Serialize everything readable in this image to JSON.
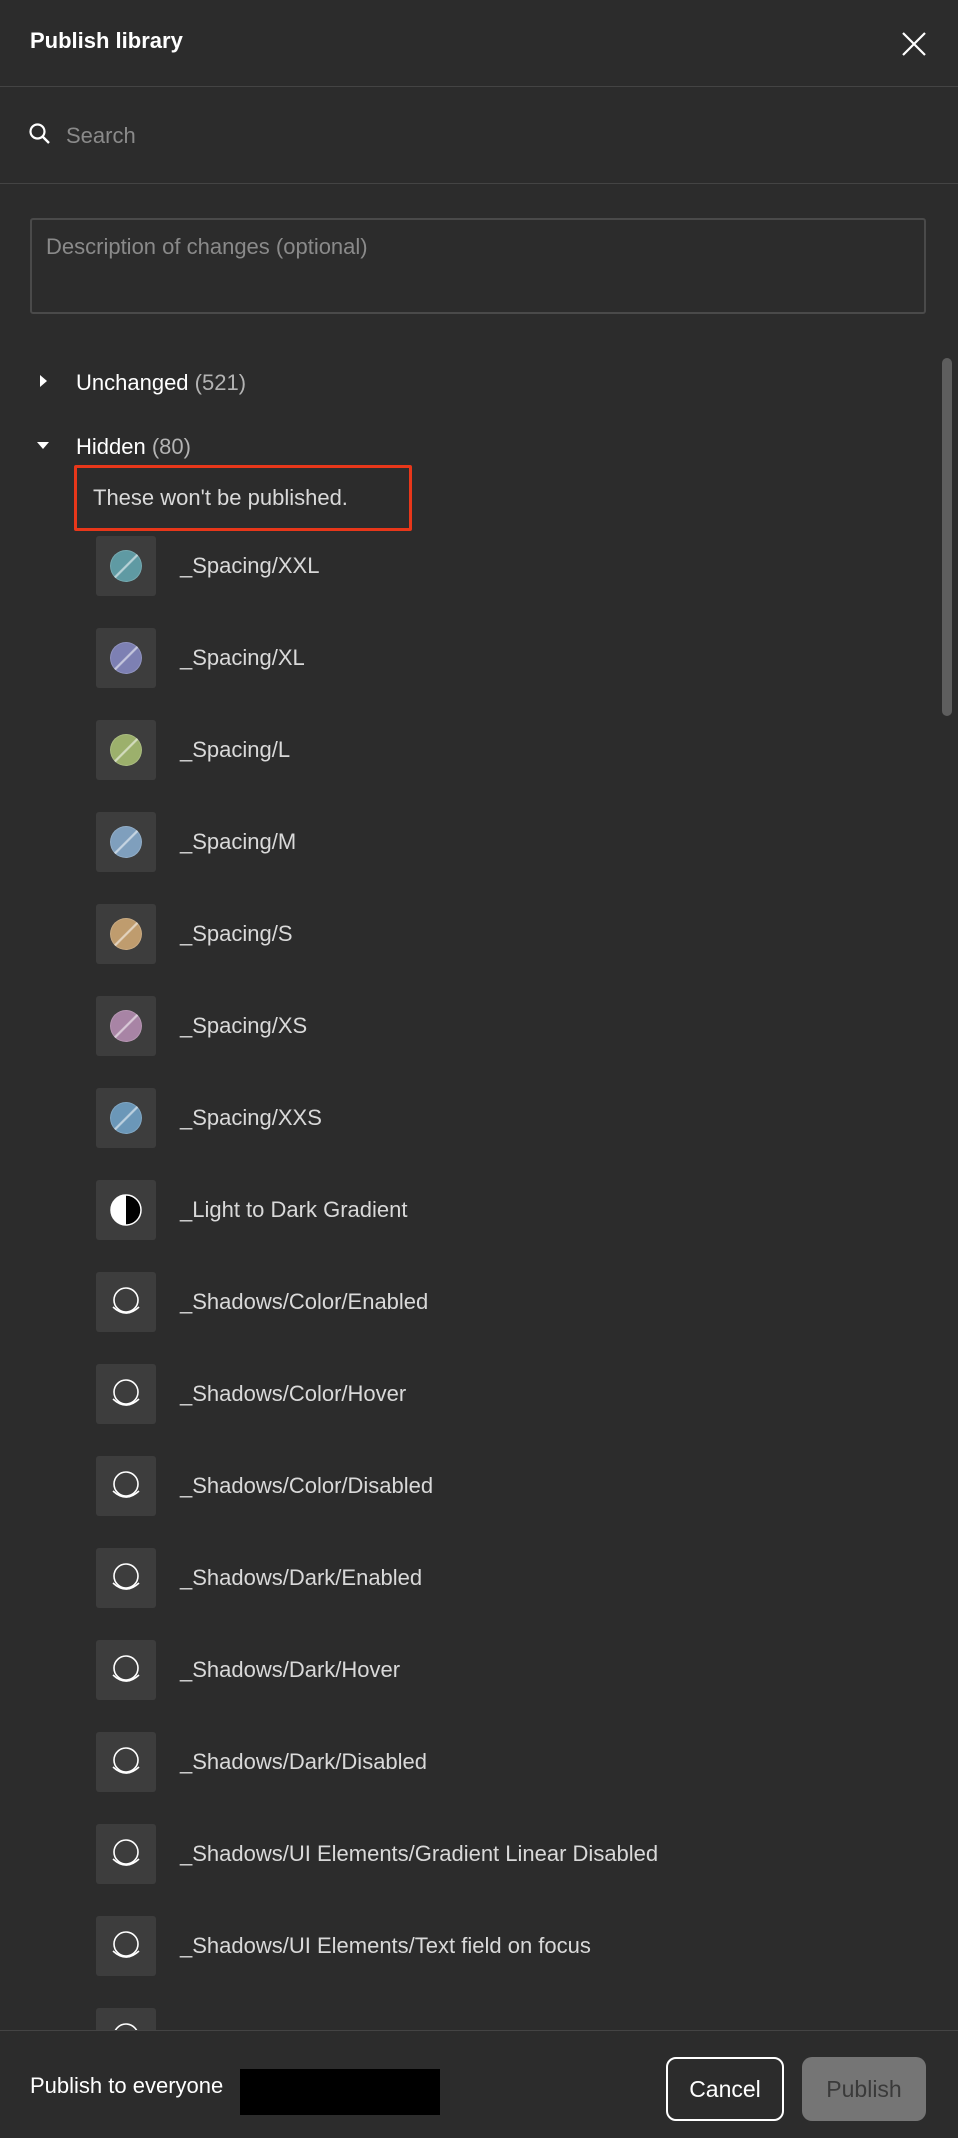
{
  "dialog": {
    "title": "Publish library"
  },
  "search": {
    "placeholder": "Search"
  },
  "description": {
    "placeholder": "Description of changes (optional)"
  },
  "groups": {
    "unchanged": {
      "label": "Unchanged",
      "count": "(521)",
      "expanded": false
    },
    "hidden": {
      "label": "Hidden",
      "count": "(80)",
      "expanded": true,
      "note": "These won't be published."
    }
  },
  "hidden_items": [
    {
      "label": "_Spacing/XXL",
      "icon": "color-swatch",
      "color": "#5f9aa3"
    },
    {
      "label": "_Spacing/XL",
      "icon": "color-swatch",
      "color": "#7d80b3"
    },
    {
      "label": "_Spacing/L",
      "icon": "color-swatch",
      "color": "#9cb06c"
    },
    {
      "label": "_Spacing/M",
      "icon": "color-swatch",
      "color": "#7f9fbd"
    },
    {
      "label": "_Spacing/S",
      "icon": "color-swatch",
      "color": "#bf9c6e"
    },
    {
      "label": "_Spacing/XS",
      "icon": "color-swatch",
      "color": "#a884a5"
    },
    {
      "label": "_Spacing/XXS",
      "icon": "color-swatch",
      "color": "#6b97b8"
    },
    {
      "label": "_Light to Dark Gradient",
      "icon": "gradient-swatch"
    },
    {
      "label": "_Shadows/Color/Enabled",
      "icon": "shadow-effect"
    },
    {
      "label": "_Shadows/Color/Hover",
      "icon": "shadow-effect"
    },
    {
      "label": "_Shadows/Color/Disabled",
      "icon": "shadow-effect"
    },
    {
      "label": "_Shadows/Dark/Enabled",
      "icon": "shadow-effect"
    },
    {
      "label": "_Shadows/Dark/Hover",
      "icon": "shadow-effect"
    },
    {
      "label": "_Shadows/Dark/Disabled",
      "icon": "shadow-effect"
    },
    {
      "label": "_Shadows/UI Elements/Gradient Linear Disabled",
      "icon": "shadow-effect"
    },
    {
      "label": "_Shadows/UI Elements/Text field on focus",
      "icon": "shadow-effect"
    },
    {
      "label": "",
      "icon": "shadow-effect"
    }
  ],
  "footer": {
    "publish_to_label": "Publish to everyone",
    "cancel_label": "Cancel",
    "publish_label": "Publish"
  },
  "colors": {
    "background": "#2c2c2c",
    "divider": "#444444",
    "highlight_border": "#e8371a",
    "publish_disabled": "#757575"
  }
}
